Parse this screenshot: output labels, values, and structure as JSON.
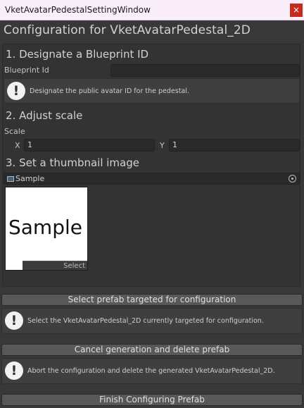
{
  "window": {
    "title": "VketAvatarPedestalSettingWindow",
    "close_glyph": "×",
    "header": "Configuration for VketAvatarPedestal_2D"
  },
  "step1": {
    "title": "1. Designate a Blueprint ID",
    "field_label": "Blueprint Id",
    "field_value": "",
    "help": "Designate the public avatar ID for the pedestal."
  },
  "step2": {
    "title": "2. Adjust scale",
    "label": "Scale",
    "x_label": "X",
    "x_value": "1",
    "y_label": "Y",
    "y_value": "1"
  },
  "step3": {
    "title": "3. Set a thumbnail image",
    "object_name": "Sample",
    "thumbnail_text": "Sample",
    "select_label": "Select"
  },
  "actions": {
    "select_prefab_label": "Select prefab targeted for configuration",
    "select_prefab_help": "Select the VketAvatarPedestal_2D currently targeted for configuration.",
    "cancel_label": "Cancel generation and delete prefab",
    "cancel_help": "Abort the configuration and delete the generated VketAvatarPedestal_2D.",
    "finish_label": "Finish Configuring Prefab"
  },
  "icons": {
    "help": "exclamation-icon",
    "object": "texture-icon",
    "picker": "object-picker-icon"
  },
  "colors": {
    "background": "#383838",
    "titlebar": "#f9eef9",
    "close": "#c42b1c",
    "button": "#585858"
  }
}
